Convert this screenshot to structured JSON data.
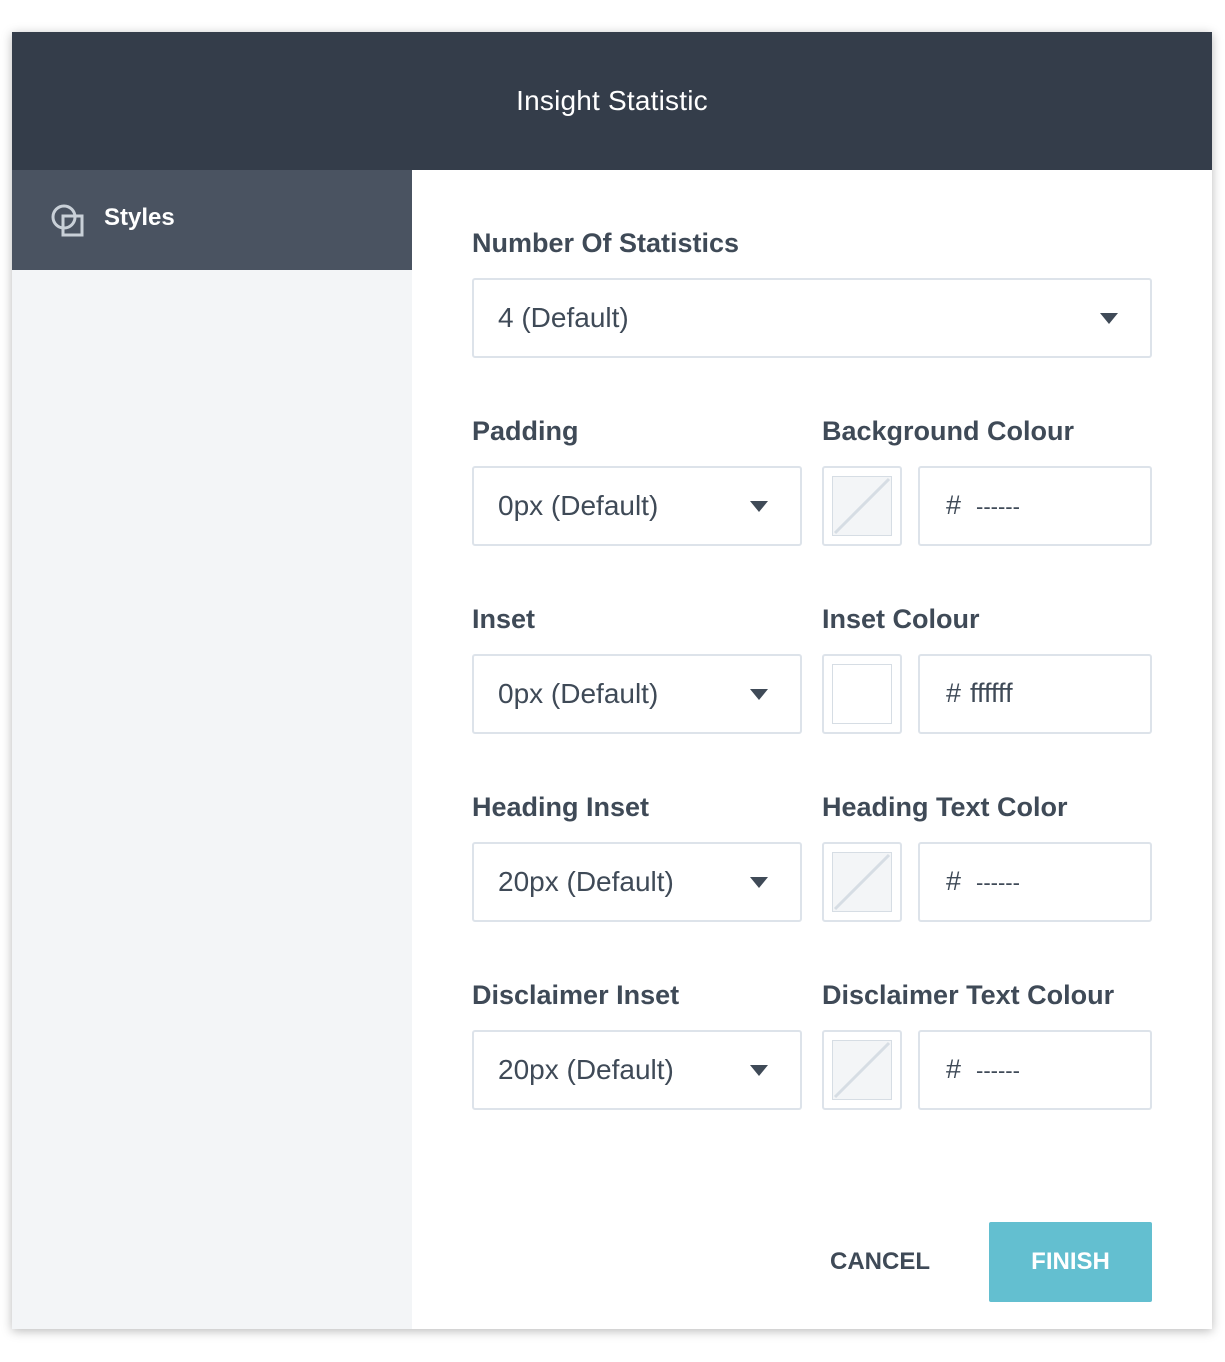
{
  "modal": {
    "title": "Insight Statistic"
  },
  "sidebar": {
    "items": [
      {
        "label": "Styles",
        "icon": "styles-icon",
        "active": true
      }
    ]
  },
  "form": {
    "number_of_statistics": {
      "label": "Number Of Statistics",
      "value": "4 (Default)"
    },
    "padding": {
      "label": "Padding",
      "value": "0px (Default)"
    },
    "background_colour": {
      "label": "Background Colour",
      "hash": "#",
      "value": "------"
    },
    "inset": {
      "label": "Inset",
      "value": "0px (Default)"
    },
    "inset_colour": {
      "label": "Inset Colour",
      "hash": "#",
      "value": "ffffff",
      "swatch": "#ffffff"
    },
    "heading_inset": {
      "label": "Heading Inset",
      "value": "20px (Default)"
    },
    "heading_text_color": {
      "label": "Heading Text Color",
      "hash": "#",
      "value": "------"
    },
    "disclaimer_inset": {
      "label": "Disclaimer Inset",
      "value": "20px (Default)"
    },
    "disclaimer_text_colour": {
      "label": "Disclaimer Text Colour",
      "hash": "#",
      "value": "------"
    }
  },
  "footer": {
    "cancel_label": "CANCEL",
    "finish_label": "FINISH"
  },
  "colors": {
    "header_bg": "#343d4a",
    "sidebar_active_bg": "#4a5361",
    "sidebar_bg": "#f3f5f7",
    "accent": "#63bfd0",
    "text": "#3f4a57"
  }
}
